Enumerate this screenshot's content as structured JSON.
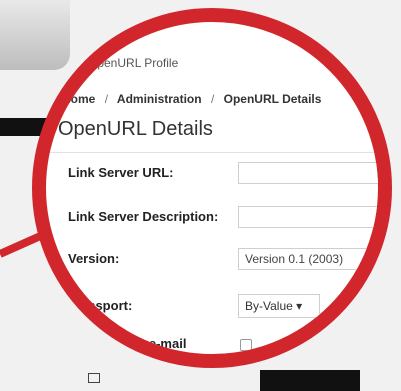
{
  "profile": {
    "title": "OpenURL Profile"
  },
  "breadcrumb": {
    "items": [
      "Home",
      "Administration",
      "OpenURL Details"
    ],
    "sep": "/"
  },
  "page": {
    "title": "OpenURL Details"
  },
  "form": {
    "link_server_url_label": "Link Server URL:",
    "link_server_url_value": "",
    "link_server_description_label": "Link Server Description:",
    "link_server_description_value": "",
    "version_label": "Version:",
    "version_value": "Version 0.1 (2003)",
    "transport_label": "Transport:",
    "transport_value": "By-Value",
    "requester_email_label": "requester e-mail"
  },
  "colors": {
    "lens_border": "#d1262b",
    "submit": "#2e9b62"
  }
}
